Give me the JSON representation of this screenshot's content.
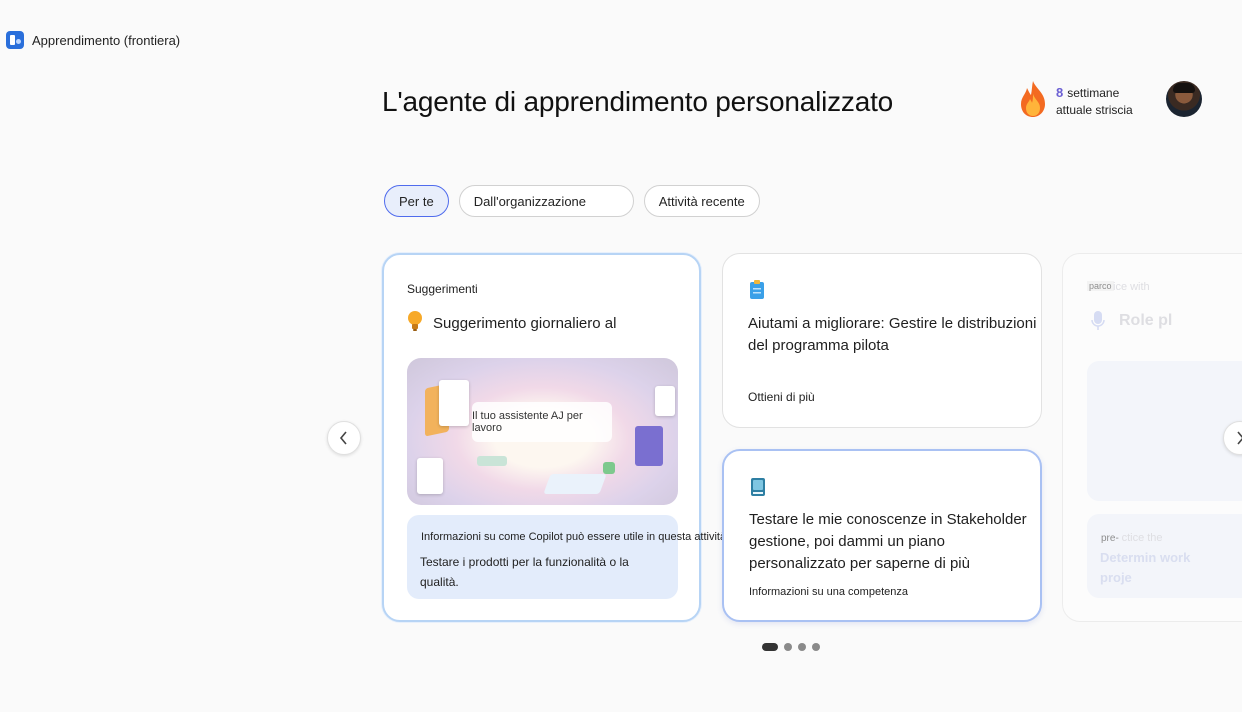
{
  "app": {
    "title": "Apprendimento (frontiera)"
  },
  "header": {
    "title": "L'agente di apprendimento personalizzato",
    "streak": {
      "count": "8",
      "unit": "settimane",
      "caption": "attuale striscia"
    }
  },
  "tabs": [
    {
      "label": "Per te",
      "active": true
    },
    {
      "label": "Dall'organizzazione",
      "active": false
    },
    {
      "label": "Attività recente",
      "active": false
    }
  ],
  "cards": {
    "tip": {
      "label": "Suggerimenti",
      "title": "Suggerimento giornaliero al",
      "image_caption": "Il tuo assistente AJ per lavoro",
      "info_heading": "Informazioni su come Copilot può essere utile in questa attività:",
      "info_text": "Testare i prodotti per la funzionalità o la qualità."
    },
    "improve": {
      "title": "Aiutami a migliorare: Gestire le distribuzioni del programma pilota",
      "link": "Ottieni di più"
    },
    "quiz": {
      "title": "Testare le mie conoscenze in Stakeholder gestione, poi dammi un piano personalizzato per saperne di più",
      "link": "Informazioni su una competenza"
    },
    "partial": {
      "tag": "parco",
      "tag_suffix": "ice with",
      "title": "Role pl",
      "info_tag": "pre-",
      "info_tag_suffix": "ctice the",
      "info_text": "Determin work proje"
    }
  },
  "pagination": {
    "total": 4,
    "current": 1
  },
  "colors": {
    "accent": "#4f6bed",
    "streak": "#6b5fd3",
    "info_bg": "#e3ecfb"
  },
  "icons": {
    "app": "learning-app-icon",
    "streak": "flame-icon",
    "tip": "lightbulb-icon",
    "improve": "clipboard-icon",
    "quiz": "book-icon",
    "partial": "microphone-icon",
    "prev": "chevron-left-icon",
    "next": "chevron-right-icon"
  }
}
